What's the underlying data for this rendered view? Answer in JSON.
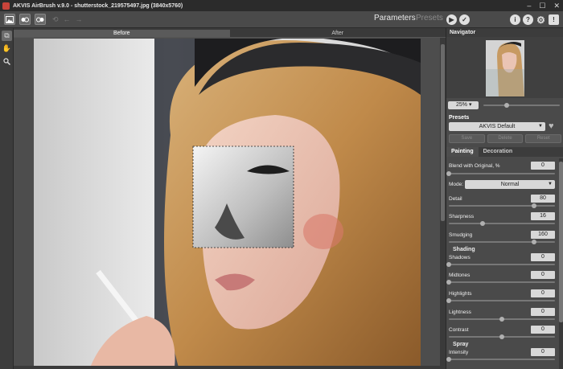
{
  "window": {
    "title": "AKVIS AirBrush v.9.0 - shutterstock_219575497.jpg (3840x5760)",
    "controls": [
      "–",
      "☐",
      "✕"
    ]
  },
  "toolbar": {
    "mode_parameters": "Parameters",
    "mode_presets": "Presets",
    "run_icon": "play-icon",
    "apply_icon": "check-icon",
    "info_icon": "info-icon",
    "help_icon": "help-icon",
    "settings_icon": "gear-icon",
    "notify_icon": "alert-icon"
  },
  "canvas": {
    "tab_before": "Before",
    "tab_after": "After",
    "active_tab": "Before"
  },
  "navigator": {
    "title": "Navigator",
    "zoom": "25%"
  },
  "presets": {
    "title": "Presets",
    "selected": "AKVIS Default",
    "save": "Save",
    "delete": "Delete",
    "reset": "Reset"
  },
  "settings_tabs": {
    "painting": "Painting",
    "decoration": "Decoration"
  },
  "params": {
    "blend": {
      "label": "Blend with Original, %",
      "value": "0",
      "fraction": 0.0
    },
    "mode_label": "Mode:",
    "mode_value": "Normal",
    "detail": {
      "label": "Detail",
      "value": "80",
      "fraction": 0.8
    },
    "sharpness": {
      "label": "Sharpness",
      "value": "16",
      "fraction": 0.32
    },
    "smudging": {
      "label": "Smudging",
      "value": "160",
      "fraction": 0.8
    },
    "shading_title": "Shading",
    "shadows": {
      "label": "Shadows",
      "value": "0",
      "fraction": 0.0
    },
    "midtones": {
      "label": "Midtones",
      "value": "0",
      "fraction": 0.0
    },
    "highlights": {
      "label": "Highlights",
      "value": "0",
      "fraction": 0.0
    },
    "lightness": {
      "label": "Lightness",
      "value": "0",
      "fraction": 0.5
    },
    "contrast": {
      "label": "Contrast",
      "value": "0",
      "fraction": 0.5
    },
    "spray_title": "Spray",
    "intensity": {
      "label": "Intensity",
      "value": "0",
      "fraction": 0.0
    }
  }
}
